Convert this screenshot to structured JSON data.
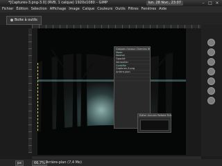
{
  "window": {
    "title": "*[Captures-3.png-3.0] (RVB, 1 calque) 1920x1080 – GIMP",
    "tray_date": "lun. 28 févr., 23:07"
  },
  "menu": [
    "Fichier",
    "Édition",
    "Sélection",
    "Affichage",
    "Image",
    "Calque",
    "Couleurs",
    "Outils",
    "Filtres",
    "Fenêtres",
    "Aide"
  ],
  "tab": {
    "label": "Boite à outils"
  },
  "floating_panel": {
    "header": "Calques  Canaux  Chemins  Histo",
    "section_1": "Mode",
    "rows_1": [
      "Normal",
      "Opacité",
      "Verrouiller"
    ],
    "section_2": "Contrôle",
    "rows_2": [
      "Captures-3.png",
      "Arrière-plan",
      "",
      ""
    ]
  },
  "panel2": {
    "header": "Éditer  Annuler  Refaire  Fich"
  },
  "statusbar": {
    "unit": "px",
    "zoom": "66,7%",
    "message": "Arrière-plan (7,4 Mo)"
  },
  "colors": {
    "selection_outline": "#c9c96a",
    "background": "#1c1c1c"
  }
}
